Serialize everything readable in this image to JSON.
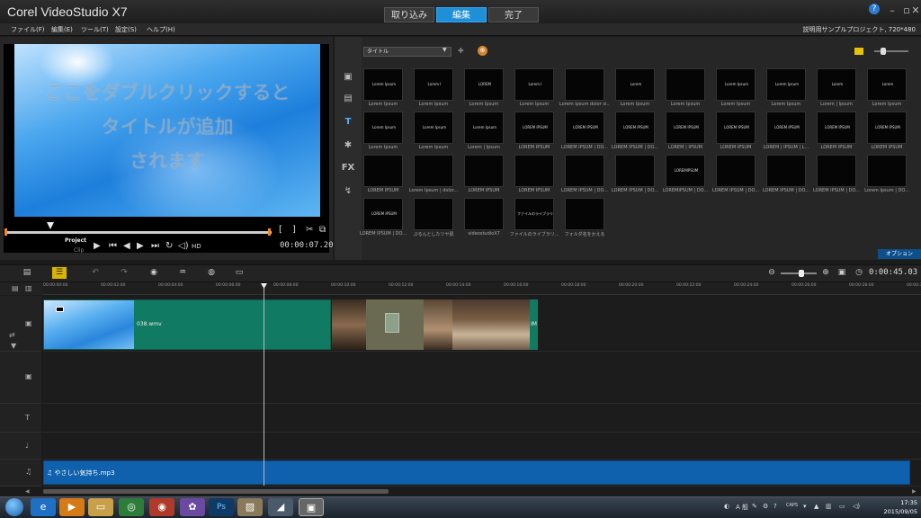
{
  "app": {
    "title": "Corel VideoStudio X7"
  },
  "steps": [
    "取り込み",
    "編集",
    "完了"
  ],
  "active_step": "編集",
  "menu": [
    "ファイル(F)",
    "編集(E)",
    "ツール(T)",
    "設定(S)",
    "ヘルプ(H)"
  ],
  "project_info": "説明用サンプルプロジェクト, 720*480",
  "player": {
    "title_lines": [
      "ここをダブルクリックすると",
      "タイトルが追加",
      "されます"
    ],
    "mode_project": "Project",
    "mode_clip": "Clip",
    "hd_label": "HD",
    "timecode": "00:00:07.20"
  },
  "library": {
    "category": "タイトル",
    "options_label": "オプション",
    "thumbs": [
      {
        "inner": "Lorem Ipsum",
        "label": "Lorem Ipsum"
      },
      {
        "inner": "Lorem I",
        "label": "Lorem Ipsum"
      },
      {
        "inner": "LOREM",
        "label": "Lorem Ipsum"
      },
      {
        "inner": "Lorem I",
        "label": "Lorem Ipsum"
      },
      {
        "inner": "",
        "label": "Lorem ipsum dolor si..."
      },
      {
        "inner": "Lorem",
        "label": "Lorem Ipsum"
      },
      {
        "inner": "",
        "label": "Lorem Ipsum"
      },
      {
        "inner": "Lorem Ipsum",
        "label": "Lorem Ipsum"
      },
      {
        "inner": "Lorem Ipsum",
        "label": "Lorem Ipsum"
      },
      {
        "inner": "Lorem",
        "label": "Lorem | Ipsum"
      },
      {
        "inner": "Lorem",
        "label": "Lorem Ipsum"
      },
      {
        "inner": "Lorem Ipsum",
        "label": "Lorem Ipsum"
      },
      {
        "inner": "Lorem Ipsum",
        "label": "Lorem Ipsum"
      },
      {
        "inner": "Lorem Ipsum",
        "label": "Lorem | Ipsum"
      },
      {
        "inner": "LOREM IPSUM",
        "label": "LOREM IPSUM"
      },
      {
        "inner": "LOREM IPSUM",
        "label": "LOREM IPSUM | DO..."
      },
      {
        "inner": "LOREM IPSUM",
        "label": "LOREM IPSUM | DO..."
      },
      {
        "inner": "LOREM IPSUM",
        "label": "LOREM | IPSUM"
      },
      {
        "inner": "LOREM IPSUM",
        "label": "LOREM IPSUM"
      },
      {
        "inner": "LOREM IPSUM",
        "label": "LOREM | IPSUM | L..."
      },
      {
        "inner": "LOREM IPSUM",
        "label": "LOREM IPSUM"
      },
      {
        "inner": "LOREM IPSUM",
        "label": "LOREM IPSUM"
      },
      {
        "inner": "",
        "label": "LOREM IPSUM"
      },
      {
        "inner": "",
        "label": "Lorem Ipsum | dolor..."
      },
      {
        "inner": "",
        "label": "LOREM IPSUM"
      },
      {
        "inner": "",
        "label": "LOREM IPSUM"
      },
      {
        "inner": "",
        "label": "LOREM IPSUM | DO..."
      },
      {
        "inner": "",
        "label": "LOREM IPSUM | DO..."
      },
      {
        "inner": "LOREMIPSUM",
        "label": "LOREMIPSUM | DO..."
      },
      {
        "inner": "",
        "label": "LOREM IPSUM | DO..."
      },
      {
        "inner": "",
        "label": "LOREM IPSUM | DO..."
      },
      {
        "inner": "",
        "label": "LOREM IPSUM | DO..."
      },
      {
        "inner": "",
        "label": "Lorem Ipsum | DO..."
      },
      {
        "inner": "LOREM IPSUM",
        "label": "LOREM IPSUM | DO..."
      },
      {
        "inner": "",
        "label": "ぷるんとしたツヤ肌"
      },
      {
        "inner": "",
        "label": "videostudioX7"
      },
      {
        "inner": "ファイルのライブラリ",
        "label": "ファイルのライブラリ..."
      },
      {
        "inner": "",
        "label": "フォルダ名をかえる"
      }
    ]
  },
  "timeline": {
    "timecode": "0:00:45.03",
    "ticks": [
      "00:00:00:00",
      "00:00:02:00",
      "00:00:04:00",
      "00:00:06:00",
      "00:00:08:00",
      "00:00:10:00",
      "00:00:12:00",
      "00:00:14:00",
      "00:00:16:00",
      "00:00:18:00",
      "00:00:20:00",
      "00:00:22:00",
      "00:00:24:00",
      "00:00:26:00",
      "00:00:28:00",
      "00:00:30:00"
    ],
    "clips": {
      "video_name": "038.wmv",
      "end_label": "IM",
      "audio_name": "♫ やさしい気持ち.mp3"
    }
  },
  "taskbar": {
    "time": "17:35",
    "date": "2015/09/05",
    "ime": "A 般"
  }
}
